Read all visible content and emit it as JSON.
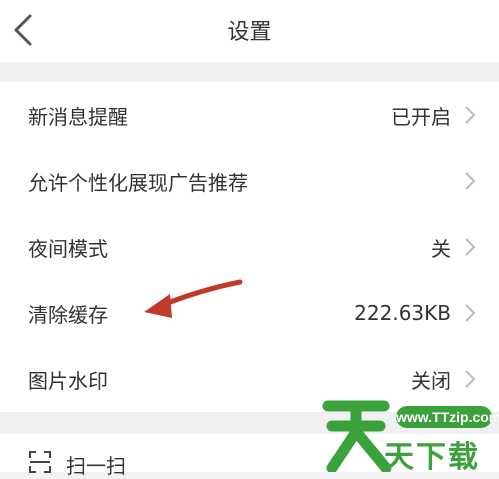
{
  "header": {
    "title": "设置"
  },
  "settings": [
    {
      "label": "新消息提醒",
      "value": "已开启"
    },
    {
      "label": "允许个性化展现广告推荐",
      "value": ""
    },
    {
      "label": "夜间模式",
      "value": "关"
    },
    {
      "label": "清除缓存",
      "value": "222.63KB"
    },
    {
      "label": "图片水印",
      "value": "关闭"
    }
  ],
  "scan": {
    "label": "扫一扫"
  },
  "watermark": {
    "url": "www.TTzip.com",
    "text": "天下载"
  },
  "colors": {
    "arrow": "#c0392b",
    "watermark": "#3ba13a"
  }
}
